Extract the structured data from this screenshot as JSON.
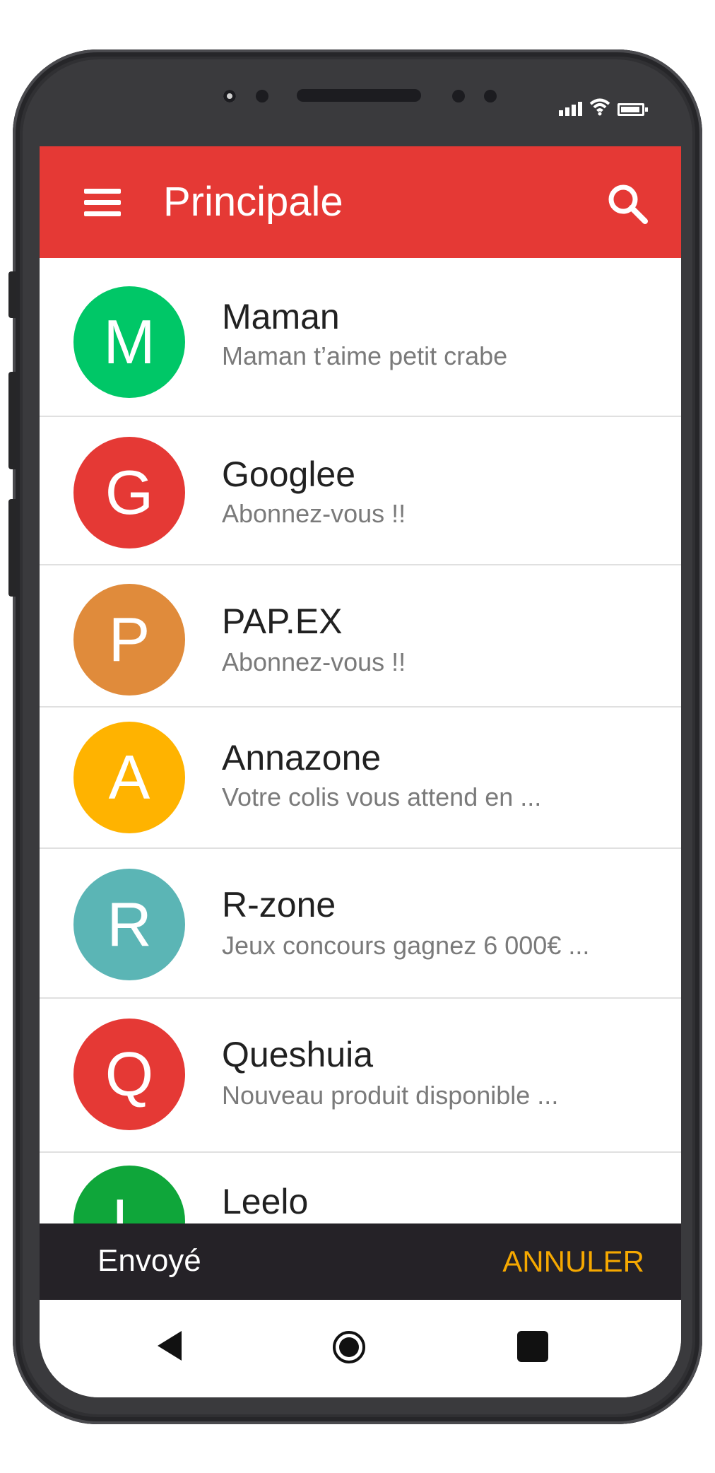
{
  "appbar": {
    "title": "Principale",
    "color": "#e53935"
  },
  "conversations": [
    {
      "initial": "M",
      "name": "Maman",
      "preview": "Maman t’aime petit crabe",
      "color": "#00c767"
    },
    {
      "initial": "G",
      "name": "Googlee",
      "preview": "Abonnez-vous !!",
      "color": "#e53935"
    },
    {
      "initial": "P",
      "name": "PAP.EX",
      "preview": "Abonnez-vous !!",
      "color": "#e08b3b"
    },
    {
      "initial": "A",
      "name": "Annazone",
      "preview": "Votre colis vous attend en ...",
      "color": "#ffb300"
    },
    {
      "initial": "R",
      "name": "R-zone",
      "preview": "Jeux concours gagnez 6 000€ ...",
      "color": "#5bb5b5"
    },
    {
      "initial": "Q",
      "name": "Queshuia",
      "preview": "Nouveau produit disponible ...",
      "color": "#e53935"
    },
    {
      "initial": "L",
      "name": "Leelo",
      "preview": "",
      "color": "#0fa63a"
    }
  ],
  "snackbar": {
    "message": "Envoyé",
    "action": "ANNULER",
    "action_color": "#f5a800"
  },
  "icons": {
    "menu": "menu-icon",
    "search": "search-icon",
    "back": "back-icon",
    "home": "home-icon",
    "recent": "recent-apps-icon",
    "signal": "signal-icon",
    "wifi": "wifi-icon",
    "battery": "battery-icon"
  }
}
